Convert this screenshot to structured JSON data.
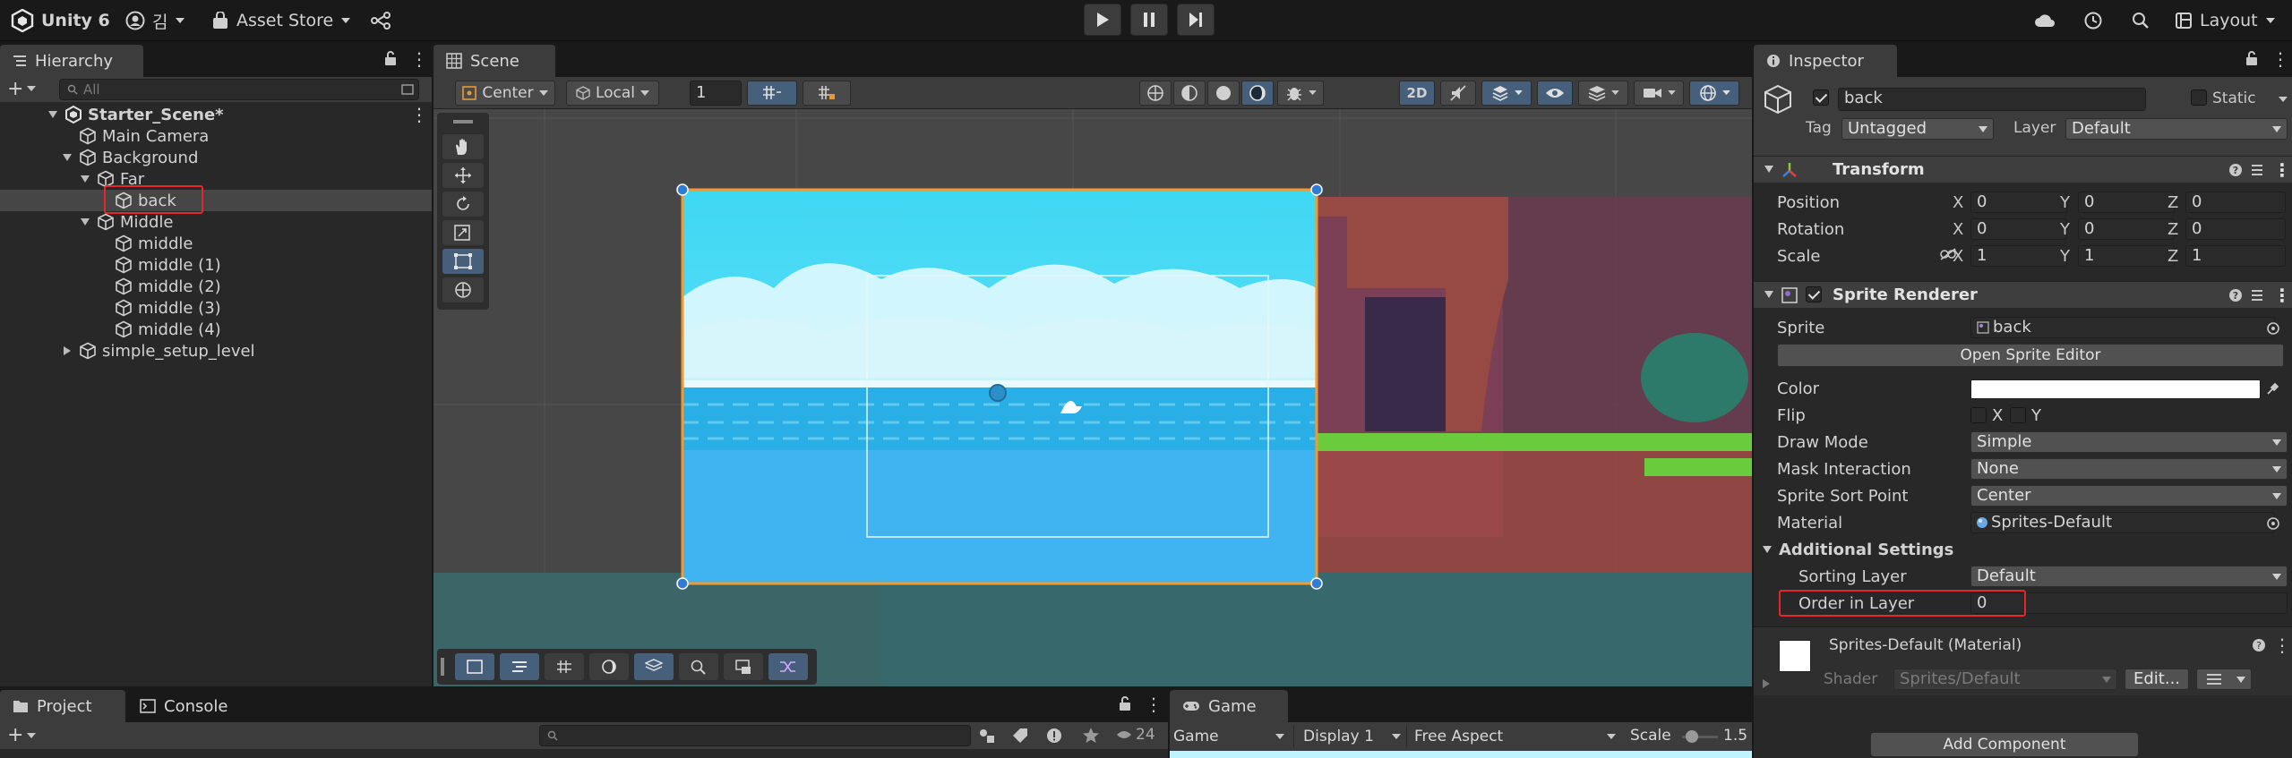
{
  "app": {
    "title": "Unity 6",
    "account": "김",
    "asset_store": "Asset Store",
    "layout": "Layout"
  },
  "hierarchy": {
    "tab": "Hierarchy",
    "search_placeholder": "All",
    "scene_name": "Starter_Scene*",
    "items": [
      {
        "label": "Main Camera",
        "depth": 1,
        "arrow": ""
      },
      {
        "label": "Background",
        "depth": 1,
        "arrow": "down"
      },
      {
        "label": "Far",
        "depth": 2,
        "arrow": "down"
      },
      {
        "label": "back",
        "depth": 3,
        "arrow": "",
        "selected": true
      },
      {
        "label": "Middle",
        "depth": 2,
        "arrow": "down"
      },
      {
        "label": "middle",
        "depth": 3,
        "arrow": ""
      },
      {
        "label": "middle (1)",
        "depth": 3,
        "arrow": ""
      },
      {
        "label": "middle (2)",
        "depth": 3,
        "arrow": ""
      },
      {
        "label": "middle (3)",
        "depth": 3,
        "arrow": ""
      },
      {
        "label": "middle (4)",
        "depth": 3,
        "arrow": ""
      },
      {
        "label": "simple_setup_level",
        "depth": 1,
        "arrow": "right"
      }
    ]
  },
  "scene": {
    "tab": "Scene",
    "pivot": "Center",
    "space": "Local",
    "grid_step": "1",
    "mode_2d": "2D"
  },
  "inspector": {
    "tab": "Inspector",
    "object_name": "back",
    "static_label": "Static",
    "tag_label": "Tag",
    "tag_value": "Untagged",
    "layer_label": "Layer",
    "layer_value": "Default",
    "transform": {
      "title": "Transform",
      "position": {
        "label": "Position",
        "x": "0",
        "y": "0",
        "z": "0"
      },
      "rotation": {
        "label": "Rotation",
        "x": "0",
        "y": "0",
        "z": "0"
      },
      "scale": {
        "label": "Scale",
        "x": "1",
        "y": "1",
        "z": "1"
      }
    },
    "sprite_renderer": {
      "title": "Sprite Renderer",
      "sprite_label": "Sprite",
      "sprite_value": "back",
      "open_editor": "Open Sprite Editor",
      "color_label": "Color",
      "color_value": "#ffffff",
      "flip_label": "Flip",
      "flip_x": "X",
      "flip_y": "Y",
      "draw_mode_label": "Draw Mode",
      "draw_mode_value": "Simple",
      "mask_label": "Mask Interaction",
      "mask_value": "None",
      "sort_point_label": "Sprite Sort Point",
      "sort_point_value": "Center",
      "material_label": "Material",
      "material_value": "Sprites-Default",
      "additional_settings": "Additional Settings",
      "sorting_layer_label": "Sorting Layer",
      "sorting_layer_value": "Default",
      "order_label": "Order in Layer",
      "order_value": "0"
    },
    "material_section": {
      "title": "Sprites-Default (Material)",
      "shader_label": "Shader",
      "shader_value": "Sprites/Default",
      "edit_button": "Edit..."
    },
    "add_component": "Add Component"
  },
  "bottom": {
    "project_tab": "Project",
    "console_tab": "Console",
    "game_tab": "Game",
    "game_dropdown": "Game",
    "display": "Display 1",
    "aspect": "Free Aspect",
    "scale_label": "Scale",
    "scale_value": "1.5",
    "hidden_count": "24"
  }
}
